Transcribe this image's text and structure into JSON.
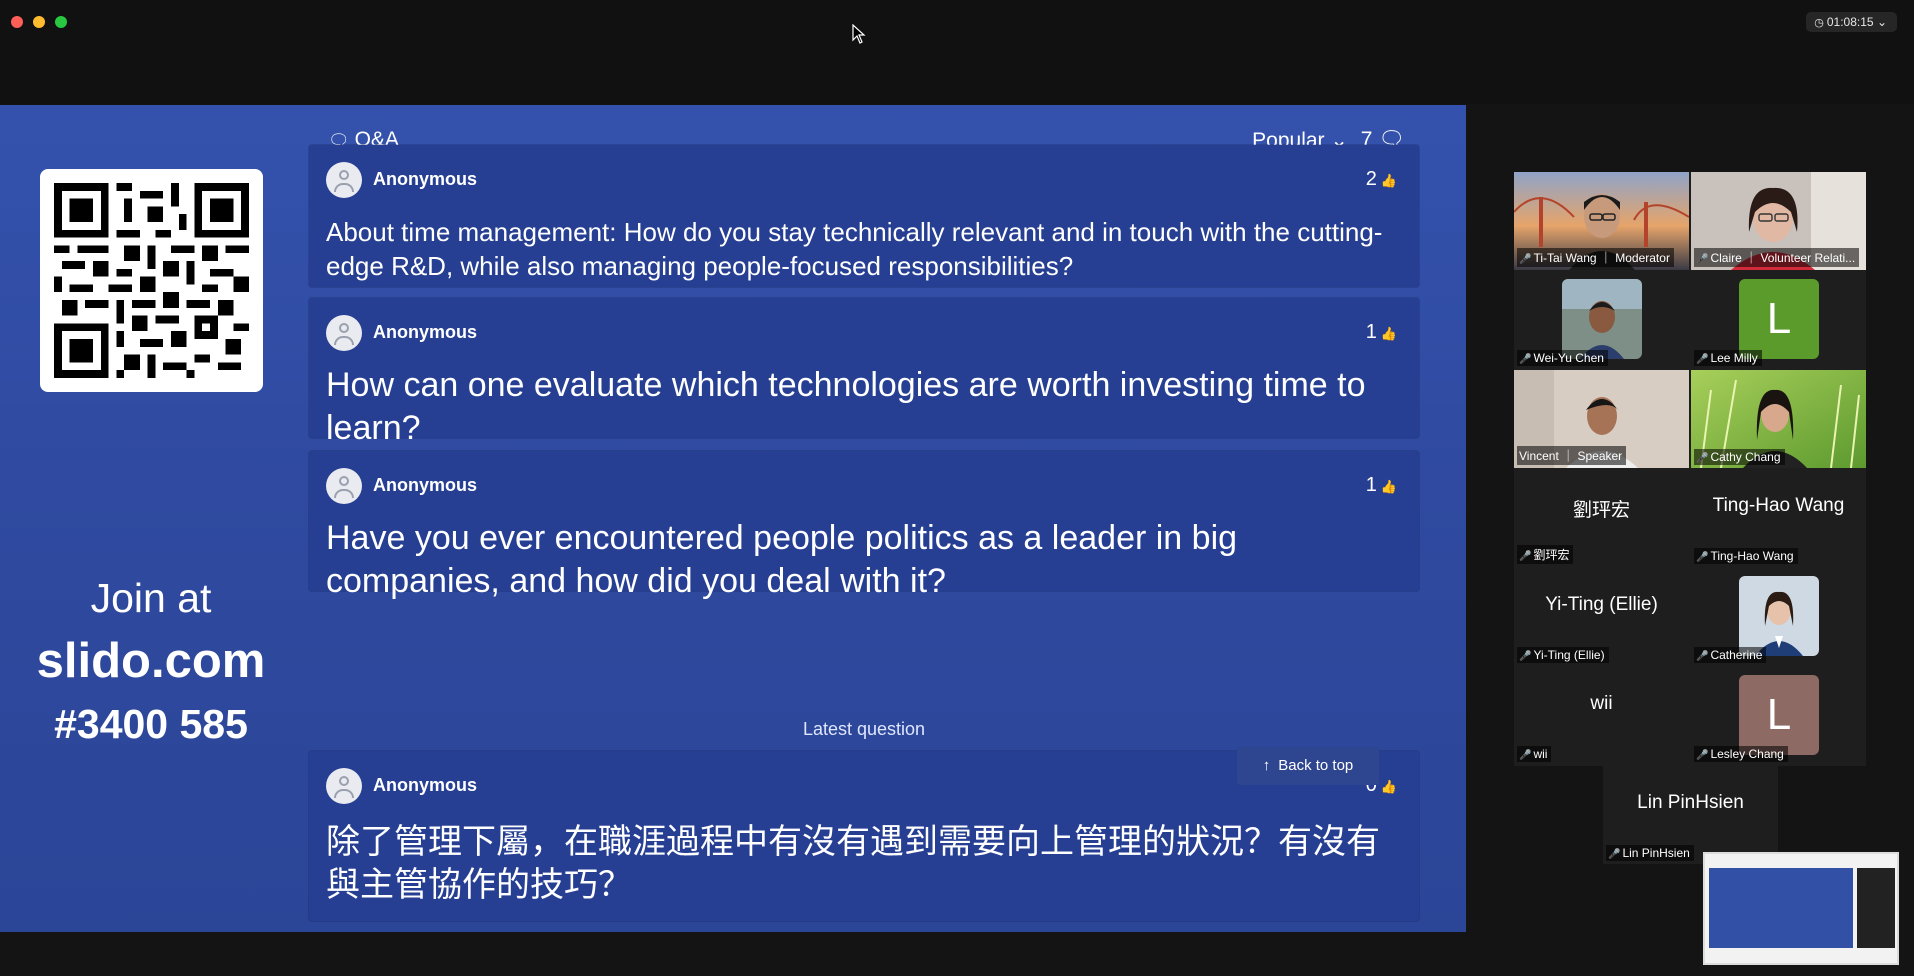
{
  "window": {
    "timer": "01:08:15"
  },
  "slido": {
    "qa_label": "Q&A",
    "sort_label": "Popular",
    "question_count": "7",
    "join_prefix": "Join at",
    "join_url": "slido.com",
    "join_code": "#3400 585",
    "latest_label": "Latest question",
    "back_to_top": "Back to top",
    "questions": [
      {
        "author": "Anonymous",
        "likes": "2",
        "text": "About time management: How do you stay technically relevant and in touch with the cutting-edge R&D, while also managing people-focused responsibilities?"
      },
      {
        "author": "Anonymous",
        "likes": "1",
        "text": "How can one evaluate which technologies are worth investing time to learn?"
      },
      {
        "author": "Anonymous",
        "likes": "1",
        "text": "Have you ever encountered people politics as a leader in big companies, and how did you deal with it?"
      },
      {
        "author": "Anonymous",
        "likes": "0",
        "text": "除了管理下屬，在職涯過程中有沒有遇到需要向上管理的狀況？有沒有與主管協作的技巧？"
      }
    ]
  },
  "participants": [
    {
      "name": "Ti-Tai Wang ｜ Moderator",
      "kind": "video"
    },
    {
      "name": "Claire ｜ Volunteer Relati...",
      "kind": "video"
    },
    {
      "name": "Wei-Yu Chen",
      "kind": "photo"
    },
    {
      "name": "Lee Milly",
      "kind": "letter",
      "letter": "L",
      "color": "#5a9b2c"
    },
    {
      "name": "Vincent ｜ Speaker",
      "kind": "video",
      "active": true
    },
    {
      "name": "Cathy Chang",
      "kind": "video"
    },
    {
      "name": "劉玶宏",
      "kind": "text",
      "display": "劉玶宏"
    },
    {
      "name": "Ting-Hao Wang",
      "kind": "text",
      "display": "Ting-Hao Wang"
    },
    {
      "name": "Yi-Ting (Ellie)",
      "kind": "text",
      "display": "Yi-Ting (Ellie)"
    },
    {
      "name": "Catherine",
      "kind": "photo"
    },
    {
      "name": "wii",
      "kind": "text",
      "display": "wii"
    },
    {
      "name": "Lesley Chang",
      "kind": "letter",
      "letter": "L",
      "color": "#8e6a64"
    },
    {
      "name": "Lin PinHsien",
      "kind": "text",
      "display": "Lin PinHsien"
    }
  ]
}
